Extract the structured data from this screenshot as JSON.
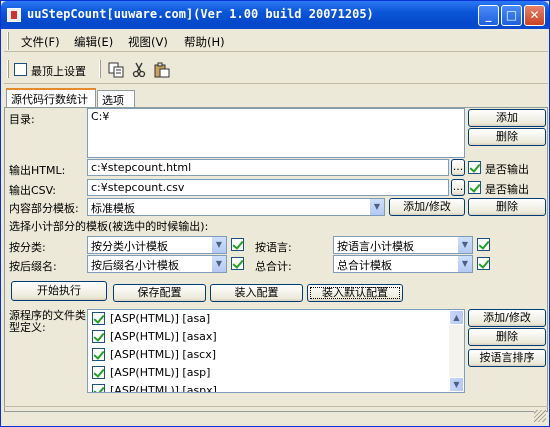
{
  "window": {
    "title": "uuStepCount[uuware.com](Ver 1.00 build 20071205)"
  },
  "menu": [
    "文件(F)",
    "编辑(E)",
    "视图(V)",
    "帮助(H)"
  ],
  "toolbar": {
    "topmost_label": "最顶上设置"
  },
  "tabs": [
    "源代码行数统计",
    "选项"
  ],
  "form": {
    "dir_label": "目录:",
    "dir_value": "C:¥",
    "add_label": "添加",
    "delete_label": "删除",
    "out_html_label": "输出HTML:",
    "out_html_value": "c:¥stepcount.html",
    "out_html_check": "是否输出",
    "out_csv_label": "输出CSV:",
    "out_csv_value": "c:¥stepcount.csv",
    "out_csv_check": "是否输出",
    "template_label": "内容部分模板:",
    "template_value": "标准模板",
    "add_edit_label": "添加/修改",
    "subtotal_note": "选择小计部分的模板(被选中的时候输出):",
    "by_category_label": "按分类:",
    "by_category_value": "按分类小计模板",
    "by_language_label": "按语言:",
    "by_language_value": "按语言小计模板",
    "by_ext_label": "按后缀名:",
    "by_ext_value": "按后缀名小计模板",
    "total_label": "总合计:",
    "total_value": "总合计模板",
    "start_label": "开始执行",
    "save_label": "保存配置",
    "load_label": "装入配置",
    "load_default_label": "装入默认配置",
    "filetype_label": "源程序的文件类型定义:",
    "sort_label": "按语言排序"
  },
  "filetypes": [
    "[ASP(HTML)] [asa]",
    "[ASP(HTML)] [asax]",
    "[ASP(HTML)] [ascx]",
    "[ASP(HTML)] [asp]",
    "[ASP(HTML)] [aspx]"
  ]
}
